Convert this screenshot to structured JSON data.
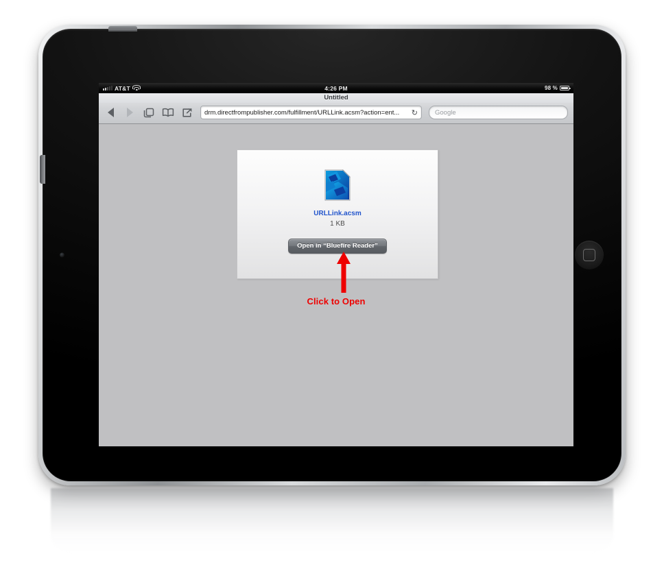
{
  "status_bar": {
    "carrier": "AT&T",
    "time": "4:26 PM",
    "battery_percent": "98 %",
    "signal_icon": "signal-bars-icon",
    "wifi_icon": "wifi-icon",
    "battery_icon": "battery-icon"
  },
  "browser": {
    "page_title": "Untitled",
    "toolbar": {
      "back_icon": "back-arrow-icon",
      "forward_icon": "forward-arrow-icon",
      "tabs_icon": "tabs-pages-icon",
      "bookmarks_icon": "bookmarks-book-icon",
      "share_icon": "share-action-icon"
    },
    "address_bar": {
      "url": "drm.directfrompublisher.com/fulfillment/URLLink.acsm?action=ent...",
      "reload_glyph": "↻"
    },
    "search_bar": {
      "placeholder": "Google",
      "value": ""
    }
  },
  "download_card": {
    "file_icon_name": "acsm-document-icon",
    "file_name": "URLLink.acsm",
    "file_size": "1 KB",
    "open_button_label": "Open in “Bluefire Reader”"
  },
  "annotation": {
    "label": "Click to Open",
    "arrow_icon": "up-arrow-annotation-icon",
    "color": "#ee0000"
  },
  "device": {
    "home_button_name": "home-button",
    "power_button_name": "power-button",
    "volume_button_name": "volume-button",
    "camera_name": "front-camera"
  },
  "colors": {
    "link_blue": "#2255cc",
    "page_background": "#c0c0c2",
    "annotation_red": "#ee0000"
  }
}
